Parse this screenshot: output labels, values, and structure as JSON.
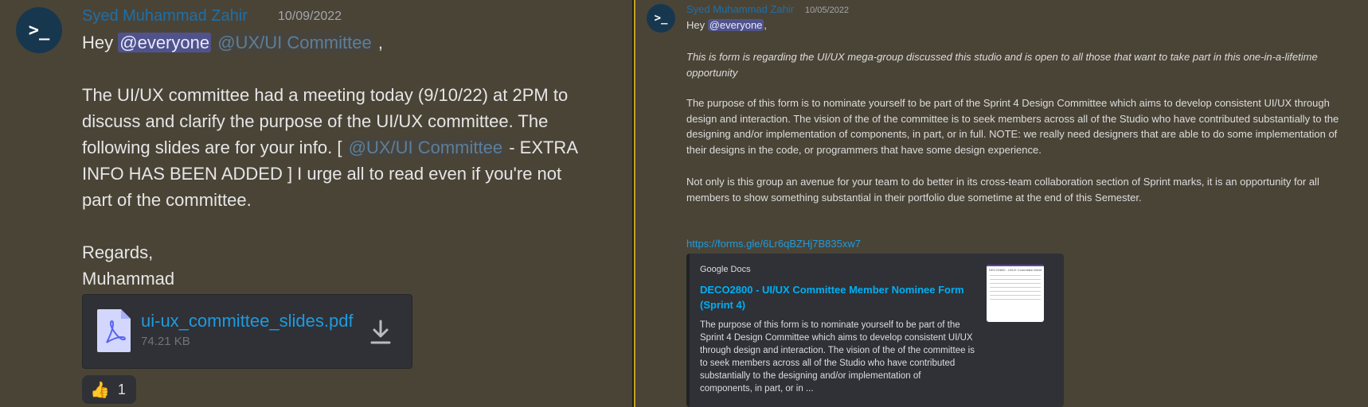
{
  "left": {
    "avatar_text": ">_",
    "author": "Syed Muhammad Zahir",
    "timestamp": "10/09/2022",
    "greeting_prefix": "Hey ",
    "mention_everyone": "@everyone",
    "mention_role": "@UX/UI Committee",
    "greeting_suffix": " ,",
    "para_1": "The UI/UX committee had a meeting today (9/10/22) at 2PM to discuss and clarify the purpose of the UI/UX committee. The following slides are for your info. [ ",
    "para_mention": "@UX/UI Committee",
    "para_2": " - EXTRA INFO HAS BEEN ADDED ] I urge all to read even if you're not part of the committee.",
    "regards": "Regards,",
    "signature": "Muhammad",
    "attachment": {
      "file_name": "ui-ux_committee_slides.pdf",
      "file_size": "74.21 KB",
      "file_icon": "pdf-file-icon",
      "download_icon": "download-icon"
    },
    "reaction": {
      "emoji": "👍",
      "count": "1"
    }
  },
  "right": {
    "avatar_text": ">_",
    "author": "Syed Muhammad Zahir",
    "timestamp": "10/05/2022",
    "greeting_prefix": "Hey ",
    "mention_everyone": "@everyone",
    "greeting_suffix": ",",
    "italic_intro": "This is form is regarding the UI/UX mega-group discussed this studio and is open to all those that want to take part in this one-in-a-lifetime opportunity",
    "para_1": "The purpose of this form is to nominate yourself to be part of the Sprint 4 Design Committee which aims to develop consistent UI/UX through design and interaction. The vision of the of the committee is to seek members across all of the Studio who have contributed substantially to the designing and/or implementation of components, in part, or in full. NOTE: we really need designers that are able to do some implementation of their designs in the code, or programmers that have some design experience.",
    "para_2": "Not only is this group an avenue for your team to do better in its cross-team collaboration section of Sprint marks, it is an opportunity for all members to show something substantial in their portfolio due sometime at the end of this Semester.",
    "link": "https://forms.gle/6Lr6qBZHj7B835xw7",
    "embed": {
      "provider": "Google Docs",
      "title": "DECO2800 - UI/UX Committee Member Nominee Form (Sprint 4)",
      "description": "The purpose of this form is to nominate yourself to be part of the Sprint 4 Design Committee which aims to develop consistent UI/UX through design and interaction. The vision of the of the committee is to seek members across all of the Studio who have contributed substantially to the designing and/or implementation of components, in part, or in ...",
      "thumbnail_text": "DECO2800 - UI/UX Committee Member Nominee Form (Sprint 4)"
    }
  },
  "colors": {
    "background": "#4a4437",
    "author": "#1e6fa8",
    "link": "#1d9be0",
    "embed_title": "#00aff4",
    "divider_accent": "#c9a227",
    "card": "#2f3136"
  }
}
